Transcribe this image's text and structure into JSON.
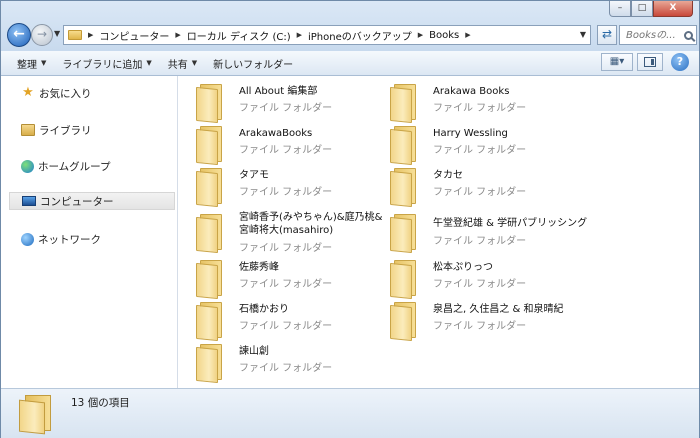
{
  "address": {
    "crumbs": [
      "コンピューター",
      "ローカル ディスク (C:)",
      "iPhoneのバックアップ",
      "Books"
    ]
  },
  "search": {
    "placeholder": "Booksの..."
  },
  "window_buttons": {
    "minimize": "–",
    "maximize": "□",
    "close": "X"
  },
  "toolbar": {
    "organize": "整理",
    "add_to_library": "ライブラリに追加",
    "share": "共有",
    "new_folder": "新しいフォルダー",
    "help": "?"
  },
  "sidebar": {
    "items": [
      {
        "label": "お気に入り",
        "icon": "star-icon"
      },
      {
        "label": "ライブラリ",
        "icon": "library-icon"
      },
      {
        "label": "ホームグループ",
        "icon": "homegroup-icon"
      },
      {
        "label": "コンピューター",
        "icon": "computer-icon",
        "selected": true
      },
      {
        "label": "ネットワーク",
        "icon": "network-icon"
      }
    ]
  },
  "folders": [
    {
      "name": "All About 編集部",
      "type": "ファイル フォルダー"
    },
    {
      "name": "Arakawa Books",
      "type": "ファイル フォルダー"
    },
    {
      "name": "ArakawaBooks",
      "type": "ファイル フォルダー"
    },
    {
      "name": "Harry Wessling",
      "type": "ファイル フォルダー"
    },
    {
      "name": "タアモ",
      "type": "ファイル フォルダー"
    },
    {
      "name": "タカセ",
      "type": "ファイル フォルダー"
    },
    {
      "name": "宮崎香予(みやちゃん)&庭乃桃&宮崎将大(masahiro)",
      "type": "ファイル フォルダー"
    },
    {
      "name": "午堂登紀雄 & 学研パブリッシング",
      "type": "ファイル フォルダー"
    },
    {
      "name": "佐藤秀峰",
      "type": "ファイル フォルダー"
    },
    {
      "name": "松本ぷりっつ",
      "type": "ファイル フォルダー"
    },
    {
      "name": "石橋かおり",
      "type": "ファイル フォルダー"
    },
    {
      "name": "泉昌之, 久住昌之 & 和泉晴紀",
      "type": "ファイル フォルダー"
    },
    {
      "name": "諫山創",
      "type": "ファイル フォルダー"
    }
  ],
  "status": {
    "item_count": "13 個の項目"
  }
}
